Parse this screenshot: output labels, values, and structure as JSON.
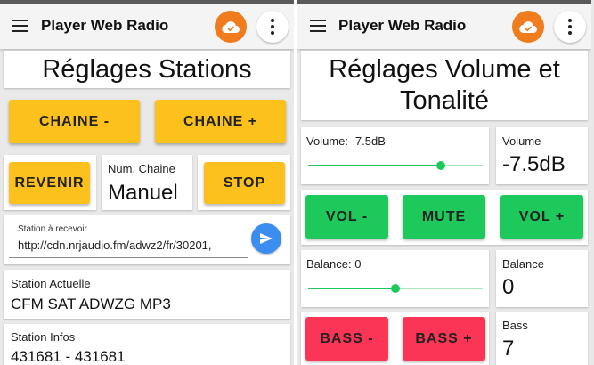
{
  "app": {
    "title": "Player Web Radio",
    "accent_color": "#f07c1e",
    "icons": {
      "menu": "hamburger-icon",
      "cloud": "cloud-check-icon",
      "overflow": "more-vert-icon",
      "send": "send-icon"
    }
  },
  "stations": {
    "heading": "Réglages Stations",
    "chaine_minus": "CHAINE -",
    "chaine_plus": "CHAINE +",
    "revenir": "REVENIR",
    "num_chaine_label": "Num. Chaine",
    "num_chaine_value": "Manuel",
    "stop": "STOP",
    "station_input_label": "Station à recevoir",
    "station_input_value": "http://cdn.nrjaudio.fm/adwz2/fr/30201,",
    "station_actuelle_label": "Station Actuelle",
    "station_actuelle_value": "CFM SAT ADWZG MP3",
    "station_infos_label": "Station Infos",
    "station_infos_value": "431681 - 431681"
  },
  "volume": {
    "heading_line1": "Réglages Volume et",
    "heading_line2": "Tonalité",
    "slider_label": "Volume: -7.5dB",
    "slider_fraction": 0.76,
    "value_label": "Volume",
    "value": "-7.5dB",
    "vol_minus": "VOL -",
    "mute": "MUTE",
    "vol_plus": "VOL +",
    "balance_slider_label": "Balance: 0",
    "balance_fraction": 0.5,
    "balance_label": "Balance",
    "balance_value": "0",
    "bass_minus": "BASS -",
    "bass_plus": "BASS +",
    "bass_label": "Bass",
    "bass_value": "7"
  },
  "colors": {
    "yellow": "#fcc11c",
    "green": "#1ec95c",
    "red": "#fb3556",
    "blue": "#3b8df0"
  }
}
